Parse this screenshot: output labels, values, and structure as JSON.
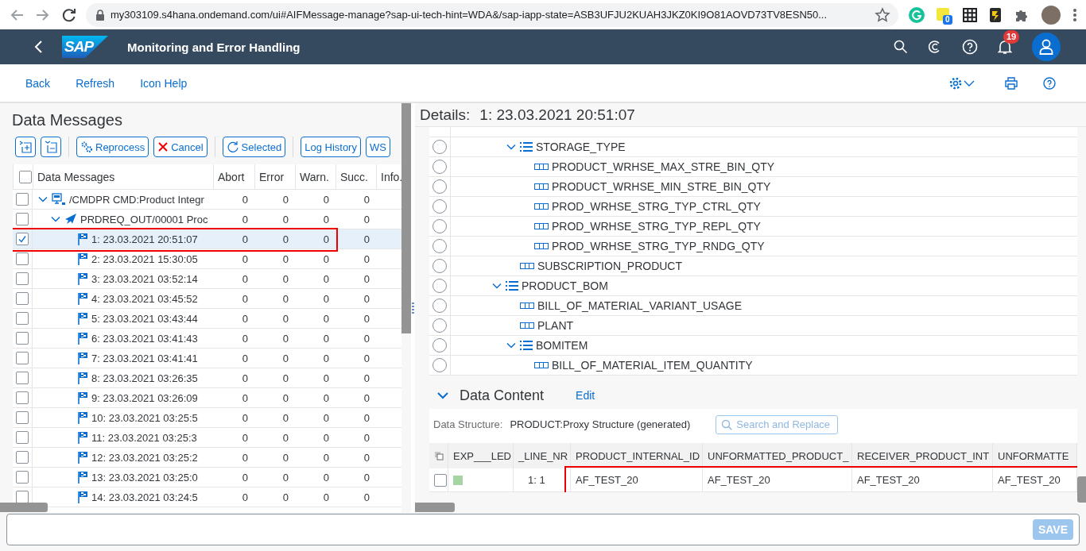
{
  "browser": {
    "url": "my303109.s4hana.ondemand.com/ui#AIFMessage-manage?sap-ui-tech-hint=WDA&/sap-iapp-state=ASB3UFJU2KUAH3JKZ0KI9O81AOVD73TV8ESN50...",
    "extension_badge": "0"
  },
  "shell": {
    "logo": "SAP",
    "title": "Monitoring and Error Handling",
    "notification_count": "19"
  },
  "toolbar": {
    "links": [
      "Back",
      "Refresh",
      "Icon Help"
    ]
  },
  "messages_panel": {
    "title": "Data Messages",
    "buttons": [
      {
        "kind": "expand_all"
      },
      {
        "kind": "collapse_all"
      },
      {
        "kind": "reprocess",
        "label": "Reprocess"
      },
      {
        "kind": "cancel",
        "label": "Cancel"
      },
      {
        "kind": "refresh",
        "label": "Selected"
      },
      {
        "kind": "text",
        "label": "Log History"
      },
      {
        "kind": "text",
        "label": "WS"
      }
    ],
    "select_all_checked": false,
    "columns": [
      "Data Messages",
      "Abort",
      "Error",
      "Warn.",
      "Succ.",
      "Info."
    ],
    "rows": [
      {
        "kind": "interface",
        "label": "/CMDPR CMD:Product Integr",
        "abort": "0",
        "error": "0",
        "warning": "0",
        "success": "0",
        "checked": false,
        "selected": false,
        "annotated": false,
        "expanded": true,
        "children": [
          {
            "kind": "message_type",
            "label": "PRDREQ_OUT/00001 Proc",
            "abort": "0",
            "error": "0",
            "warning": "0",
            "success": "0",
            "checked": false,
            "selected": false,
            "annotated": false,
            "expanded": true,
            "children": [
              {
                "kind": "message",
                "label": "1: 23.03.2021 20:51:07",
                "abort": "0",
                "error": "0",
                "warning": "0",
                "success": "0",
                "checked": true,
                "selected": true,
                "annotated": true
              },
              {
                "kind": "message",
                "label": "2: 23.03.2021 15:30:05",
                "abort": "0",
                "error": "0",
                "warning": "0",
                "success": "0",
                "checked": false,
                "selected": false,
                "annotated": false
              },
              {
                "kind": "message",
                "label": "3: 23.03.2021 03:52:14",
                "abort": "0",
                "error": "0",
                "warning": "0",
                "success": "0",
                "checked": false,
                "selected": false,
                "annotated": false
              },
              {
                "kind": "message",
                "label": "4: 23.03.2021 03:45:52",
                "abort": "0",
                "error": "0",
                "warning": "0",
                "success": "0",
                "checked": false,
                "selected": false,
                "annotated": false
              },
              {
                "kind": "message",
                "label": "5: 23.03.2021 03:43:44",
                "abort": "0",
                "error": "0",
                "warning": "0",
                "success": "0",
                "checked": false,
                "selected": false,
                "annotated": false
              },
              {
                "kind": "message",
                "label": "6: 23.03.2021 03:41:43",
                "abort": "0",
                "error": "0",
                "warning": "0",
                "success": "0",
                "checked": false,
                "selected": false,
                "annotated": false
              },
              {
                "kind": "message",
                "label": "7: 23.03.2021 03:41:41",
                "abort": "0",
                "error": "0",
                "warning": "0",
                "success": "0",
                "checked": false,
                "selected": false,
                "annotated": false
              },
              {
                "kind": "message",
                "label": "8: 23.03.2021 03:26:35",
                "abort": "0",
                "error": "0",
                "warning": "0",
                "success": "0",
                "checked": false,
                "selected": false,
                "annotated": false
              },
              {
                "kind": "message",
                "label": "9: 23.03.2021 03:26:09",
                "abort": "0",
                "error": "0",
                "warning": "0",
                "success": "0",
                "checked": false,
                "selected": false,
                "annotated": false
              },
              {
                "kind": "message",
                "label": "10: 23.03.2021 03:25:5",
                "abort": "0",
                "error": "0",
                "warning": "0",
                "success": "0",
                "checked": false,
                "selected": false,
                "annotated": false
              },
              {
                "kind": "message",
                "label": "11: 23.03.2021 03:25:3",
                "abort": "0",
                "error": "0",
                "warning": "0",
                "success": "0",
                "checked": false,
                "selected": false,
                "annotated": false
              },
              {
                "kind": "message",
                "label": "12: 23.03.2021 03:25:2",
                "abort": "0",
                "error": "0",
                "warning": "0",
                "success": "0",
                "checked": false,
                "selected": false,
                "annotated": false
              },
              {
                "kind": "message",
                "label": "13: 23.03.2021 03:25:0",
                "abort": "0",
                "error": "0",
                "warning": "0",
                "success": "0",
                "checked": false,
                "selected": false,
                "annotated": false
              },
              {
                "kind": "message",
                "label": "14: 23.03.2021 03:24:5",
                "abort": "0",
                "error": "0",
                "warning": "0",
                "success": "0",
                "checked": false,
                "selected": false,
                "annotated": false
              }
            ]
          }
        ]
      }
    ]
  },
  "details": {
    "label": "Details:",
    "title": "1: 23.03.2021 20:51:07",
    "tree": [
      {
        "children": [
          {
            "kind": "node",
            "label": "STORAGE_TYPE",
            "expanded": true,
            "selected": false,
            "children": [
              {
                "kind": "field",
                "label": "PRODUCT_WRHSE_MAX_STRE_BIN_QTY",
                "selected": false
              },
              {
                "kind": "field",
                "label": "PRODUCT_WRHSE_MIN_STRE_BIN_QTY",
                "selected": false
              },
              {
                "kind": "field",
                "label": "PROD_WRHSE_STRG_TYP_CTRL_QTY",
                "selected": false
              },
              {
                "kind": "field",
                "label": "PROD_WRHSE_STRG_TYP_REPL_QTY",
                "selected": false
              },
              {
                "kind": "field",
                "label": "PROD_WRHSE_STRG_TYP_RNDG_QTY",
                "selected": false
              }
            ]
          },
          {
            "kind": "field",
            "label": "SUBSCRIPTION_PRODUCT",
            "selected": false
          }
        ]
      },
      {
        "kind": "node",
        "label": "PRODUCT_BOM",
        "expanded": true,
        "selected": false,
        "children": [
          {
            "kind": "field",
            "label": "BILL_OF_MATERIAL_VARIANT_USAGE",
            "selected": false
          },
          {
            "kind": "field",
            "label": "PLANT",
            "selected": false
          },
          {
            "kind": "node",
            "label": "BOMITEM",
            "expanded": true,
            "selected": false,
            "children": [
              {
                "kind": "field",
                "label": "BILL_OF_MATERIAL_ITEM_QUANTITY",
                "selected": false
              }
            ]
          }
        ]
      }
    ]
  },
  "data_content": {
    "title": "Data Content",
    "expanded": true,
    "edit_link": "Edit",
    "structure_label": "Data Structure:",
    "structure": "PRODUCT:Proxy Structure (generated)",
    "search_placeholder": "Search and Replace",
    "columns": [
      "EXP___LED",
      "_LINE_NR",
      "PRODUCT_INTERNAL_ID",
      "UNFORMATTED_PRODUCT_",
      "RECEIVER_PRODUCT_INT",
      "UNFORMATTE"
    ],
    "rows": [
      {
        "checked": false,
        "color": "#a6d4a3",
        "line_nr": "1: 1",
        "values": [
          {
            "text": "AF_TEST_20",
            "annotated": true
          },
          {
            "text": "AF_TEST_20",
            "annotated": true
          },
          {
            "text": "AF_TEST_20",
            "annotated": true
          },
          {
            "text": "AF_TEST_20",
            "annotated": true
          }
        ]
      }
    ]
  },
  "footer": {
    "save": {
      "label": "SAVE",
      "disabled": true
    }
  }
}
